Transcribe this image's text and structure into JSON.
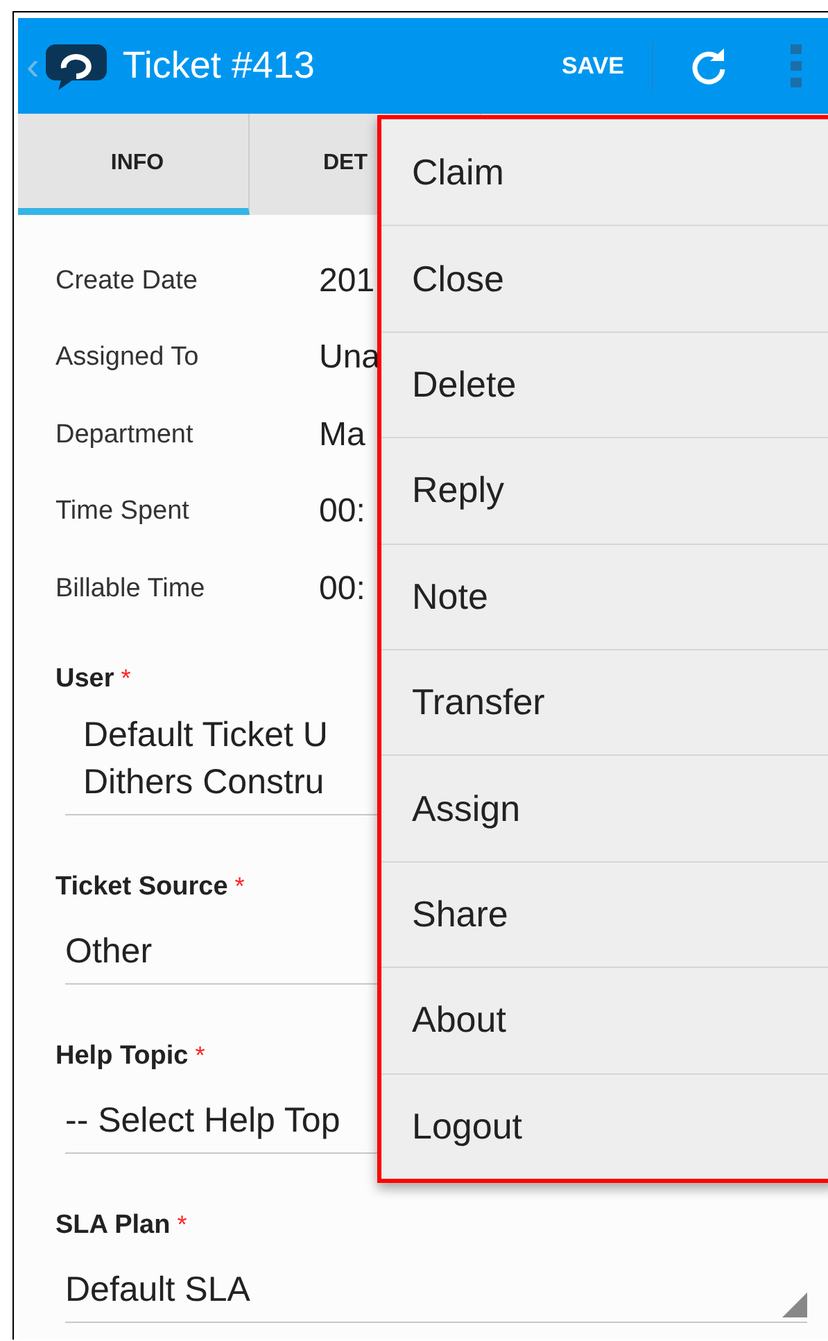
{
  "app_bar": {
    "back": "‹",
    "title": "Ticket #413",
    "save": "SAVE"
  },
  "tabs": [
    {
      "label": "INFO",
      "selected": true
    },
    {
      "label": "DET",
      "selected": false
    }
  ],
  "info_rows": [
    {
      "label": "Create Date",
      "value": "201"
    },
    {
      "label": "Assigned To",
      "value": "Una"
    },
    {
      "label": "Department",
      "value": "Ma"
    },
    {
      "label": "Time Spent",
      "value": "00:"
    },
    {
      "label": "Billable Time",
      "value": "00:"
    }
  ],
  "form_fields": [
    {
      "label": "User",
      "required_mark": "*",
      "lines": [
        "Default Ticket U",
        "Dithers Constru"
      ]
    },
    {
      "label": "Ticket Source",
      "required_mark": "*",
      "lines": [
        "Other"
      ]
    },
    {
      "label": "Help Topic",
      "required_mark": "*",
      "lines": [
        "-- Select Help Top"
      ]
    }
  ],
  "sla_plan": {
    "label": "SLA Plan",
    "required_mark": "*",
    "lines": [
      "Default SLA"
    ],
    "dropdown_arrow": true
  },
  "overflow_menu": [
    {
      "label": "Claim"
    },
    {
      "label": "Close"
    },
    {
      "label": "Delete"
    },
    {
      "label": "Reply"
    },
    {
      "label": "Note"
    },
    {
      "label": "Transfer"
    },
    {
      "label": "Assign"
    },
    {
      "label": "Share"
    },
    {
      "label": "About"
    },
    {
      "label": "Logout"
    }
  ]
}
